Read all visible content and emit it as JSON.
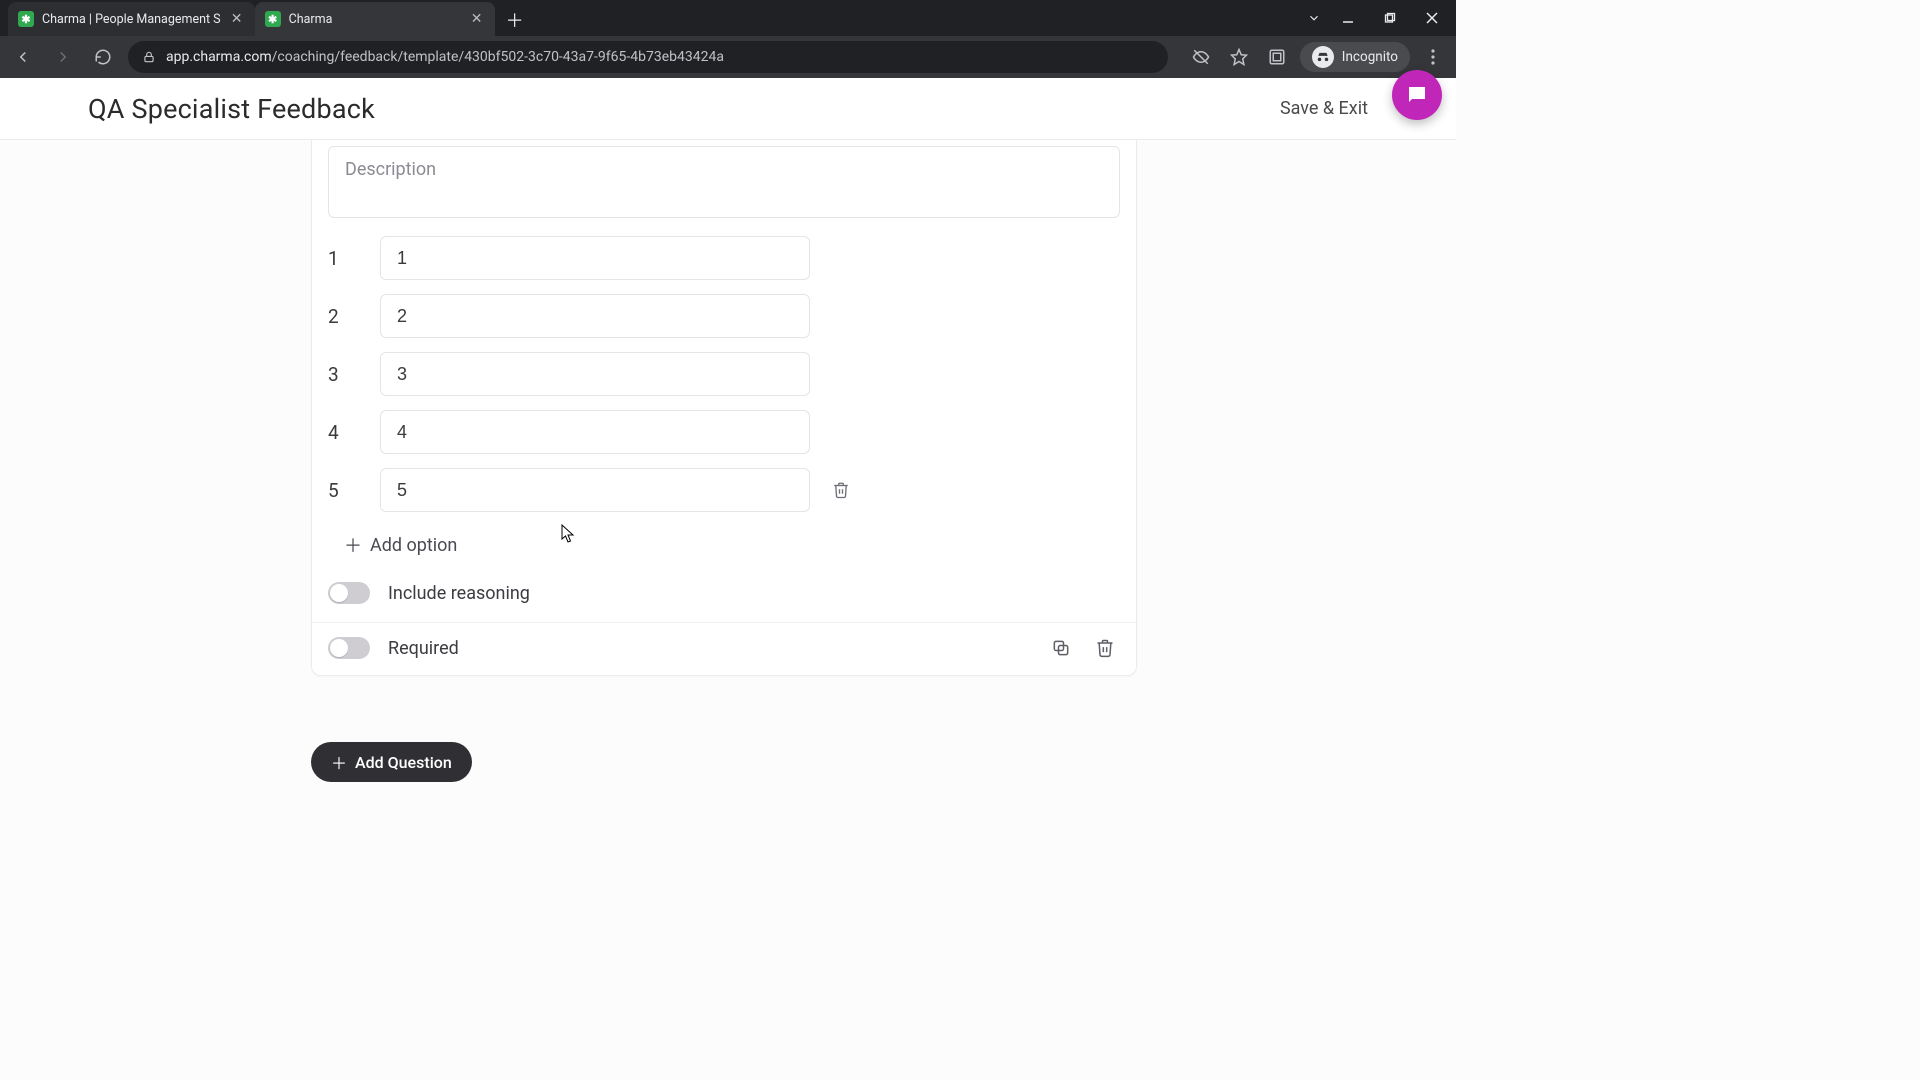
{
  "browser": {
    "tabs": [
      {
        "title": "Charma | People Management S",
        "active": false
      },
      {
        "title": "Charma",
        "active": true
      }
    ],
    "url_host": "app.charma.com",
    "url_path": "/coaching/feedback/template/430bf502-3c70-43a7-9f65-4b73eb43424a",
    "incognito_label": "Incognito"
  },
  "header": {
    "title": "QA Specialist Feedback",
    "save_exit": "Save & Exit"
  },
  "card": {
    "description_placeholder": "Description",
    "options": [
      {
        "num": "1",
        "value": "1",
        "delete": false
      },
      {
        "num": "2",
        "value": "2",
        "delete": false
      },
      {
        "num": "3",
        "value": "3",
        "delete": false
      },
      {
        "num": "4",
        "value": "4",
        "delete": false
      },
      {
        "num": "5",
        "value": "5",
        "delete": true
      }
    ],
    "add_option_label": "Add option",
    "include_reasoning_label": "Include reasoning",
    "required_label": "Required"
  },
  "add_question_label": "Add Question"
}
